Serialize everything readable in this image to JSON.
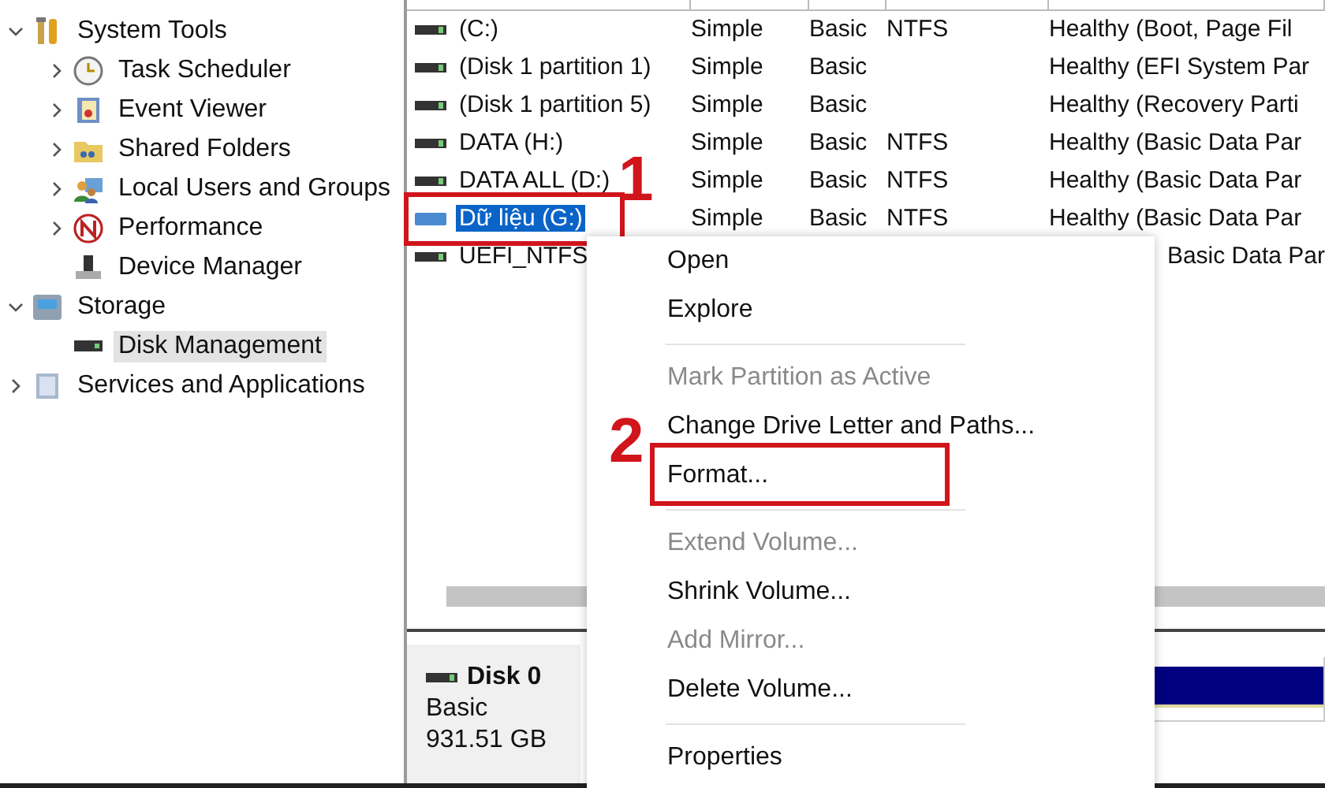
{
  "tree": [
    {
      "label": "System Tools",
      "expanded": true,
      "selected": false,
      "children": [
        {
          "label": "Task Scheduler",
          "expanded": false,
          "selected": false
        },
        {
          "label": "Event Viewer",
          "expanded": false,
          "selected": false
        },
        {
          "label": "Shared Folders",
          "expanded": false,
          "selected": false
        },
        {
          "label": "Local Users and Groups",
          "expanded": false,
          "selected": false
        },
        {
          "label": "Performance",
          "expanded": false,
          "selected": false
        },
        {
          "label": "Device Manager",
          "selected": false
        }
      ]
    },
    {
      "label": "Storage",
      "expanded": true,
      "selected": false,
      "children": [
        {
          "label": "Disk Management",
          "selected": true
        }
      ]
    },
    {
      "label": "Services and Applications",
      "expanded": false,
      "selected": false
    }
  ],
  "volumes": [
    {
      "volume": "(C:)",
      "layout": "Simple",
      "type": "Basic",
      "file_system": "NTFS",
      "status": "Healthy (Boot, Page Fil",
      "selected": false
    },
    {
      "volume": "(Disk 1 partition 1)",
      "layout": "Simple",
      "type": "Basic",
      "status": "Healthy (EFI System Par",
      "selected": false
    },
    {
      "volume": "(Disk 1 partition 5)",
      "layout": "Simple",
      "type": "Basic",
      "status": "Healthy (Recovery Parti",
      "selected": false
    },
    {
      "volume": "DATA (H:)",
      "layout": "Simple",
      "type": "Basic",
      "file_system": "NTFS",
      "status": "Healthy (Basic Data Par",
      "selected": false
    },
    {
      "volume": "DATA ALL (D:)",
      "layout": "Simple",
      "type": "Basic",
      "file_system": "NTFS",
      "status": "Healthy (Basic Data Par",
      "selected": false
    },
    {
      "volume": "Dữ liệu (G:)",
      "layout": "Simple",
      "type": "Basic",
      "file_system": "NTFS",
      "status": "Healthy (Basic Data Par",
      "selected": true,
      "callout": "1"
    },
    {
      "volume": "UEFI_NTFS",
      "status": "Basic Data Par",
      "selected": false,
      "covered": true
    }
  ],
  "disk": {
    "name": "Disk 0",
    "type": "Basic",
    "size": "931.51 GB"
  },
  "context_menu": [
    {
      "kind": "item",
      "label": "Open",
      "disabled": false
    },
    {
      "kind": "item",
      "label": "Explore",
      "disabled": false
    },
    {
      "kind": "separator"
    },
    {
      "kind": "item",
      "label": "Mark Partition as Active",
      "disabled": true
    },
    {
      "kind": "item",
      "label": "Change Drive Letter and Paths...",
      "disabled": false
    },
    {
      "kind": "item",
      "label": "Format...",
      "disabled": false,
      "callout": "2"
    },
    {
      "kind": "separator"
    },
    {
      "kind": "item",
      "label": "Extend Volume...",
      "disabled": true
    },
    {
      "kind": "item",
      "label": "Shrink Volume...",
      "disabled": false
    },
    {
      "kind": "item",
      "label": "Add Mirror...",
      "disabled": true
    },
    {
      "kind": "item",
      "label": "Delete Volume...",
      "disabled": false
    },
    {
      "kind": "separator"
    },
    {
      "kind": "item",
      "label": "Properties",
      "disabled": false
    }
  ]
}
